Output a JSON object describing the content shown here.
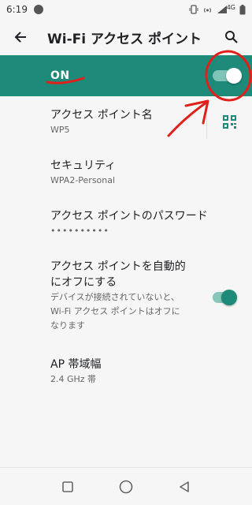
{
  "status": {
    "time": "6:19",
    "network": "4G"
  },
  "header": {
    "title": "Wi-Fi アクセス ポイント"
  },
  "master": {
    "label": "ON"
  },
  "items": [
    {
      "title": "アクセス ポイント名",
      "subtitle": "WP5"
    },
    {
      "title": "セキュリティ",
      "subtitle": "WPA2-Personal"
    },
    {
      "title": "アクセス ポイントのパスワード",
      "subtitle": "••••••••••"
    },
    {
      "title": "アクセス ポイントを自動的",
      "title2": "にオフにする",
      "subtitle": "デバイスが接続されていないと、",
      "subtitle2": "Wi-Fi アクセス ポイントはオフに",
      "subtitle3": "なります"
    },
    {
      "title": "AP 帯域幅",
      "subtitle": "2.4 GHz 帯"
    }
  ],
  "colors": {
    "accent": "#1e8a7a",
    "annotation": "#e0201a"
  },
  "icons": [
    "back-arrow-icon",
    "search-icon",
    "qr-code-icon",
    "square-nav-icon",
    "circle-nav-icon",
    "triangle-nav-icon"
  ]
}
